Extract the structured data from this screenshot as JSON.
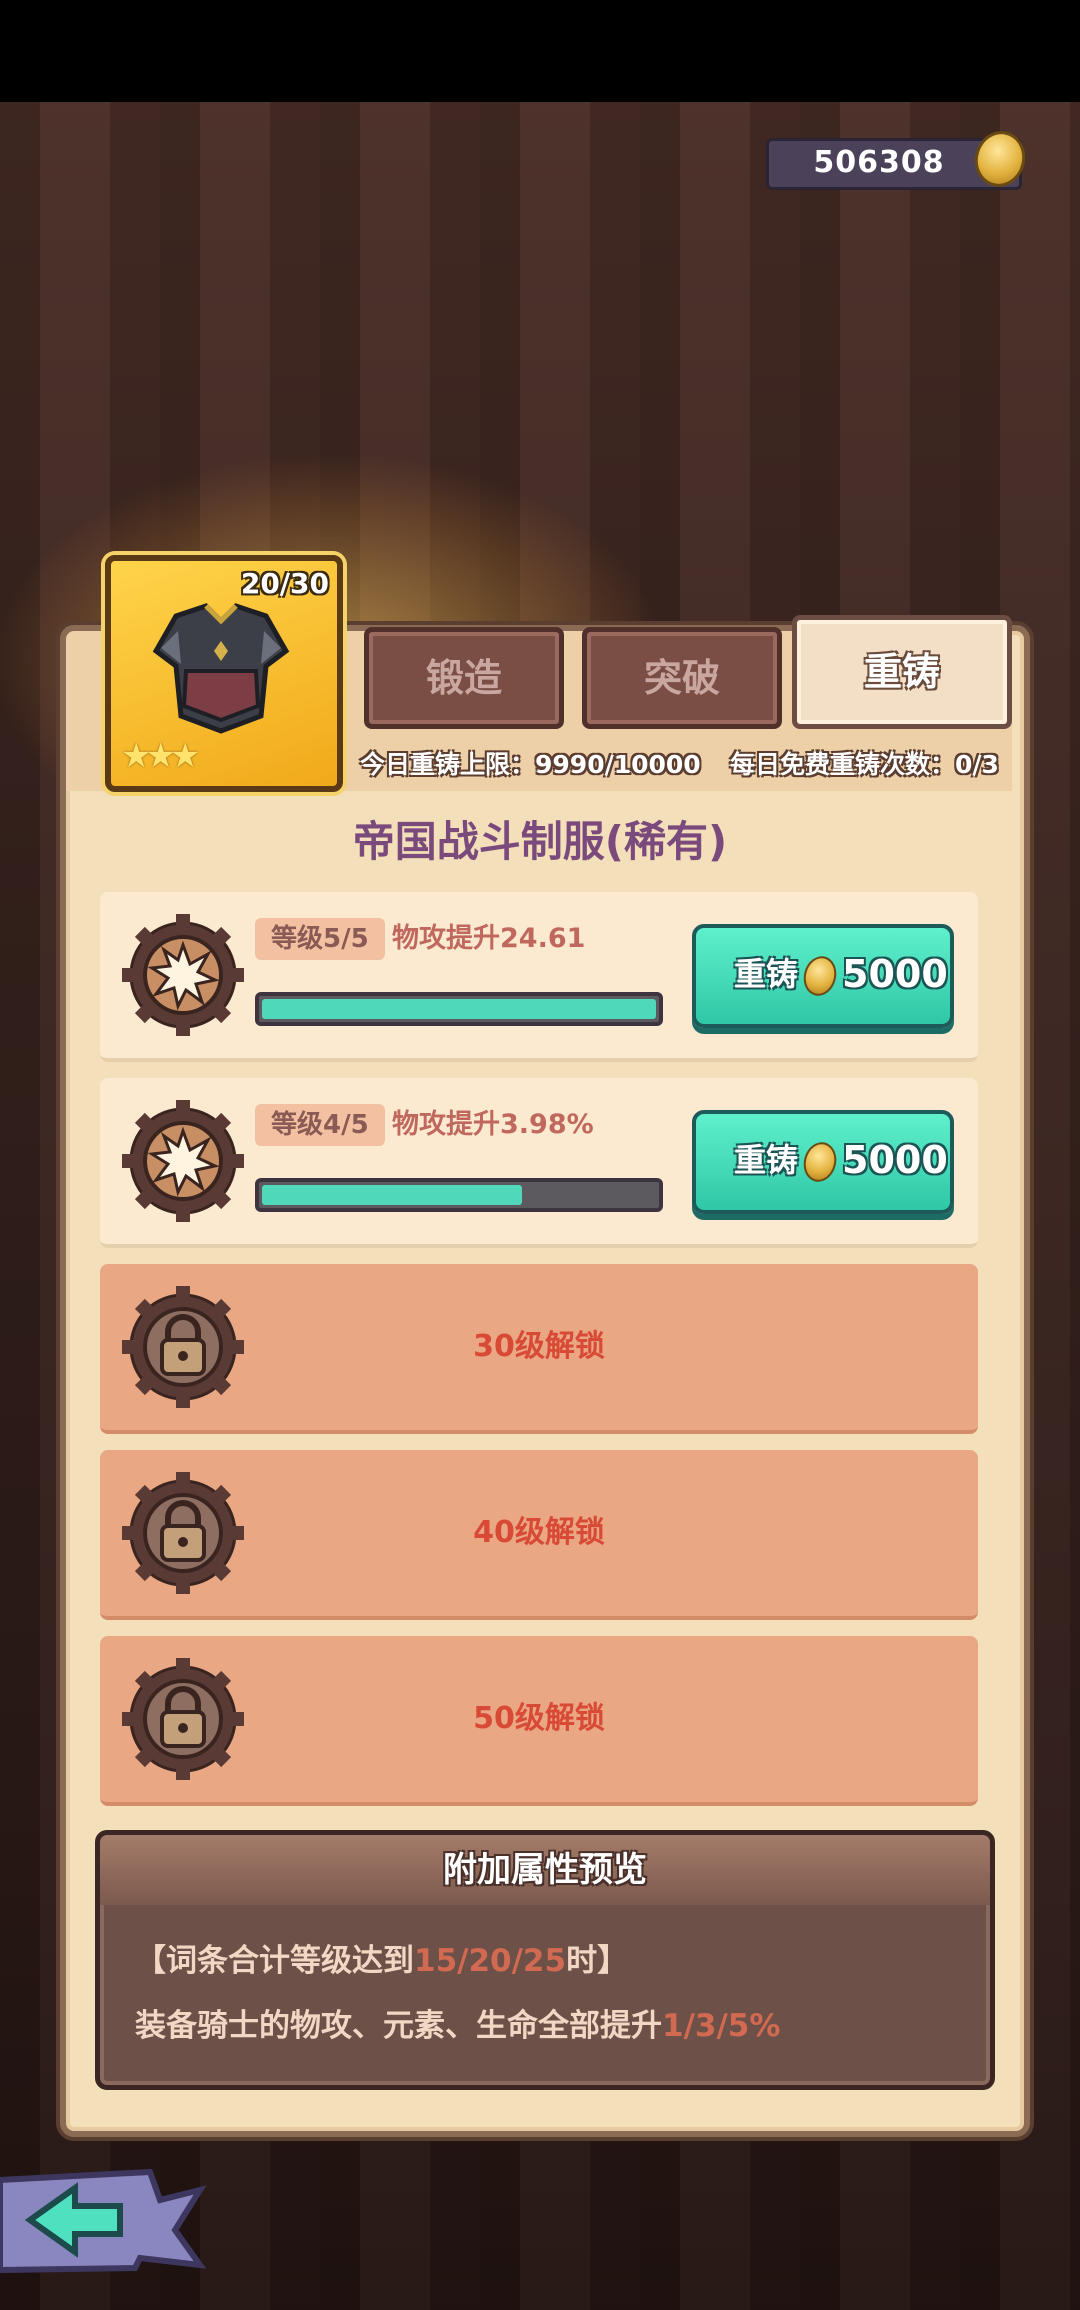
{
  "currency": {
    "gold": "506308",
    "icon": "gold-coin-icon"
  },
  "item": {
    "level": "20/30",
    "stars": 3,
    "icon": "armor-icon"
  },
  "tabs": [
    {
      "label": "锻造",
      "active": false
    },
    {
      "label": "突破",
      "active": false
    },
    {
      "label": "重铸",
      "active": true
    }
  ],
  "info": {
    "daily_limit_label": "今日重铸上限：",
    "daily_limit_value": "9990/10000",
    "free_count_label": "每日免费重铸次数：",
    "free_count_value": "0/3"
  },
  "equipment_name": "帝国战斗制服(稀有)",
  "affixes": [
    {
      "level": "等级5/5",
      "stat": "物攻提升24.61",
      "progress": 1.0,
      "button_label": "重铸",
      "cost": "5000",
      "icon": "explosion-gear-icon"
    },
    {
      "level": "等级4/5",
      "stat": "物攻提升3.98%",
      "progress": 0.66,
      "button_label": "重铸",
      "cost": "5000",
      "icon": "explosion-gear-icon"
    }
  ],
  "locked_slots": [
    {
      "text": "30级解锁",
      "icon": "lock-gear-icon"
    },
    {
      "text": "40级解锁",
      "icon": "lock-gear-icon"
    },
    {
      "text": "50级解锁",
      "icon": "lock-gear-icon"
    }
  ],
  "preview": {
    "title": "附加属性预览",
    "line1_prefix": "【词条合计等级达到",
    "line1_highlight": "15/20/25",
    "line1_suffix": "时】",
    "line2_prefix": "装备骑士的物攻、元素、生命全部提升",
    "line2_highlight": "1/3/5%"
  },
  "colors": {
    "teal_button": "#4fd8b9",
    "locked_row": "#e9a784",
    "locked_text": "#d84a36",
    "name_purple": "#7b4a7c"
  }
}
